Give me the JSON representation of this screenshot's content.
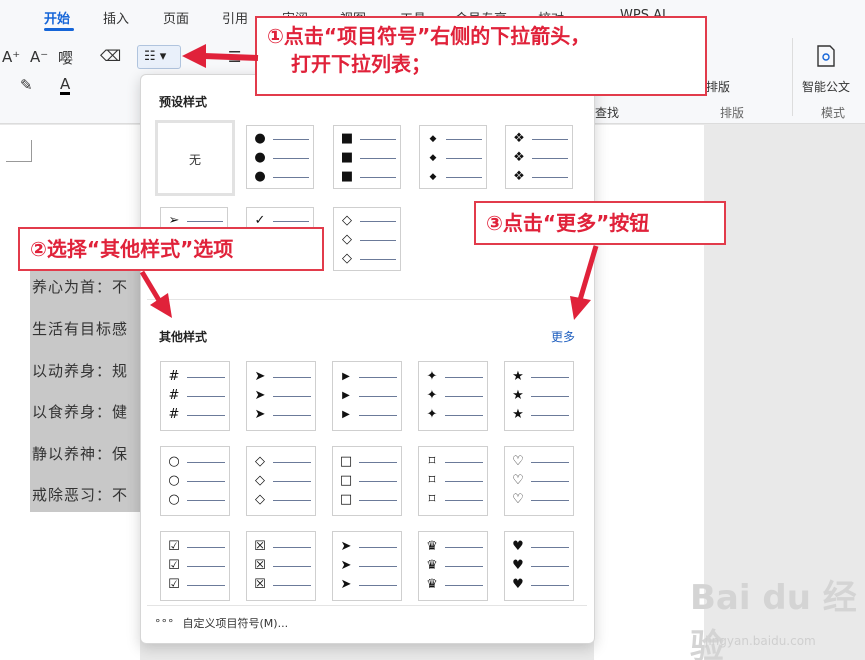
{
  "menu": {
    "tabs": [
      "开始",
      "插入",
      "页面",
      "引用",
      "审阅",
      "视图",
      "工具",
      "会员专享",
      "校对",
      "WPS AI"
    ]
  },
  "ribbon": {
    "icons": {
      "font_grow": "A⁺",
      "font_shrink": "A⁻",
      "phonetic": "嘤",
      "eraser": "⌫",
      "highlighter": "✎",
      "font_color": "A",
      "bullets": "☷ ▾",
      "multilevel": "☰"
    },
    "right_tools": {
      "layout_label": "排版",
      "find_label": "查找",
      "arrange_label": "排版",
      "smart_doc_label": "智能公文",
      "template_label": "模式"
    }
  },
  "panel": {
    "preset_title": "预设样式",
    "none_label": "无",
    "other_title": "其他样式",
    "more_label": "更多",
    "custom_label": "自定义项目符号(M)...",
    "custom_dots": "°°°",
    "preset_symbols": [
      "●",
      "■",
      "◆",
      "❖",
      "➢",
      "✓",
      "◇"
    ],
    "other_symbols": [
      "#",
      "➤",
      "▶",
      "✦",
      "★",
      "○",
      "◇",
      "□",
      "⌑",
      "♡",
      "☑",
      "☒",
      "➤",
      "♛",
      "♥"
    ]
  },
  "document": {
    "lines": [
      "养心为首：不",
      "生活有目标感",
      "以动养身：规",
      "以食养身：健",
      "静以养神：保",
      "戒除恶习：不"
    ]
  },
  "annotations": {
    "step1_line1": "①点击“项目符号”右侧的下拉箭头，",
    "step1_line2": "打开下拉列表；",
    "step2": "②选择“其他样式”选项",
    "step3": "③点击“更多”按钮"
  },
  "colors": {
    "accent": "#1565d8",
    "annotation_red": "#e0223a",
    "selection_gray": "#c8c8c8"
  },
  "watermark": {
    "main": "Bai du 经验",
    "sub": "jingyan.baidu.com"
  }
}
